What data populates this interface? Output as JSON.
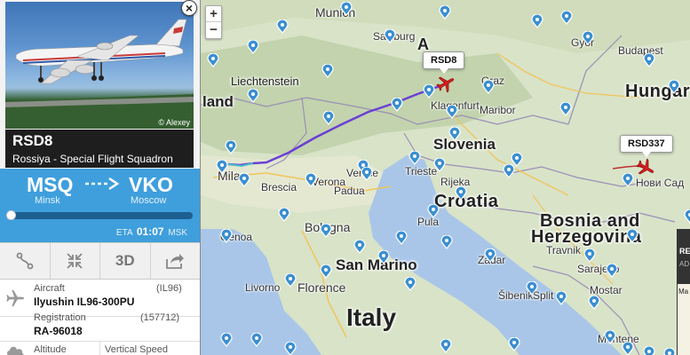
{
  "map": {
    "zoom_in": "+",
    "zoom_out": "−",
    "countries": {
      "liechtenstein": "Liechtenstein",
      "land": "land",
      "slovenia": "Slovenia",
      "croatia": "Croatia",
      "bosnia_1": "Bosnia and",
      "bosnia_2": "Herzegovina",
      "hungary": "Hungary",
      "san_marino": "San Marino",
      "italy": "Italy",
      "austria_partial": "A"
    },
    "cities": {
      "munich": "Munich",
      "salzburg": "Salzburg",
      "graz": "Graz",
      "klagenfurt": "Klagenfurt",
      "maribor": "Maribor",
      "gyor": "Győr",
      "budapest": "Budapest",
      "novi_sad": "Нови Сад",
      "milan": "Milan",
      "brescia": "Brescia",
      "verona": "Verona",
      "venice": "Venice",
      "padua": "Padua",
      "trieste": "Trieste",
      "pula": "Pula",
      "rijeka": "Rijeka",
      "genoa": "Genoa",
      "bologna": "Bologna",
      "livorno": "Livorno",
      "florence": "Florence",
      "zadar": "Zadar",
      "sibenik": "Šibenik",
      "split": "Split",
      "mostar": "Mostar",
      "travnik": "Travnik",
      "sarajevo": "Sarajevo",
      "montenegro": "Montene"
    },
    "flights": [
      {
        "callsign": "RSD8"
      },
      {
        "callsign": "RSD337"
      }
    ],
    "ad": {
      "line1": "RE",
      "line2": "AD",
      "line3": "Ma"
    }
  },
  "panel": {
    "photo_credit": "© Alexey",
    "close_label": "×",
    "callsign": "RSD8",
    "operator": "Rossiya - Special Flight Squadron",
    "route": {
      "from_code": "MSQ",
      "from_city": "Minsk",
      "to_code": "VKO",
      "to_city": "Moscow",
      "progress": 0.02,
      "eta_label": "ETA",
      "eta_time": "01:07",
      "eta_tz": "MSK"
    },
    "actions": {
      "route_icon": "route-icon",
      "fit_icon": "fit-view-icon",
      "view_3d": "3D",
      "share_icon": "share-icon"
    },
    "details": {
      "aircraft_label": "Aircraft",
      "aircraft_code": "(IL96)",
      "aircraft_value": "Ilyushin IL96-300PU",
      "registration_label": "Registration",
      "registration_code": "(157712)",
      "registration_value": "RA-96018",
      "altitude_label": "Altitude",
      "vspeed_label": "Vertical Speed"
    }
  },
  "colors": {
    "route_bg": "#3f9fdc",
    "track": "#6a3fd6",
    "pin": "#3b8fd0",
    "plane": "#d32020"
  }
}
